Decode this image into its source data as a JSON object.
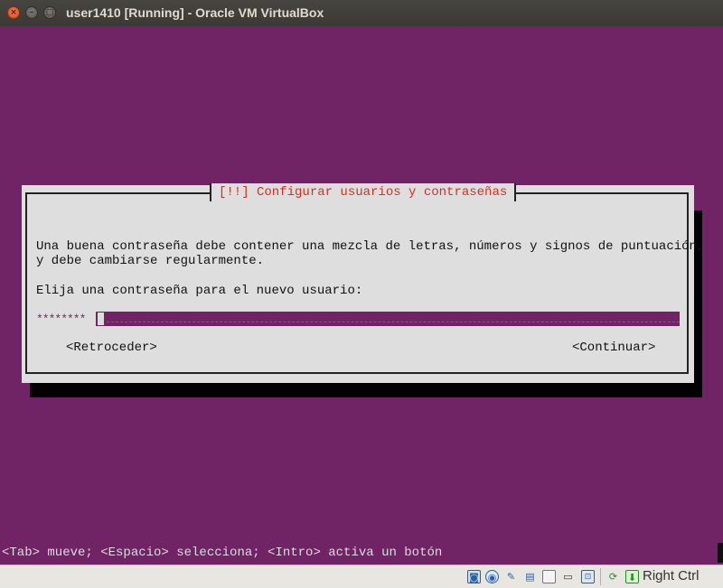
{
  "window": {
    "title": "user1410 [Running] - Oracle VM VirtualBox",
    "close_glyph": "×",
    "min_glyph": "–",
    "max_glyph": "□"
  },
  "dialog": {
    "title": "[!!] Configurar usuarios y contraseñas",
    "description_line1": "Una buena contraseña debe contener una mezcla de letras, números y signos de puntuación,",
    "description_line2": "y debe cambiarse regularmente.",
    "prompt": "Elija una contraseña para el nuevo usuario:",
    "password_value": "********",
    "back_button": "<Retroceder>",
    "continue_button": "<Continuar>"
  },
  "footer_hint": "<Tab> mueve; <Espacio> selecciona; <Intro> activa un botón",
  "statusbar": {
    "icons": [
      "hard-disk-icon",
      "optical-drive-icon",
      "usb-icon",
      "shared-folders-icon",
      "display-icon",
      "video-capture-icon",
      "network-icon",
      "mouse-integration-icon",
      "host-key-icon"
    ],
    "host_key": "Right Ctrl"
  },
  "colors": {
    "installer_background": "#702466",
    "dialog_background": "#dedede",
    "dialog_title": "#d4301e"
  }
}
